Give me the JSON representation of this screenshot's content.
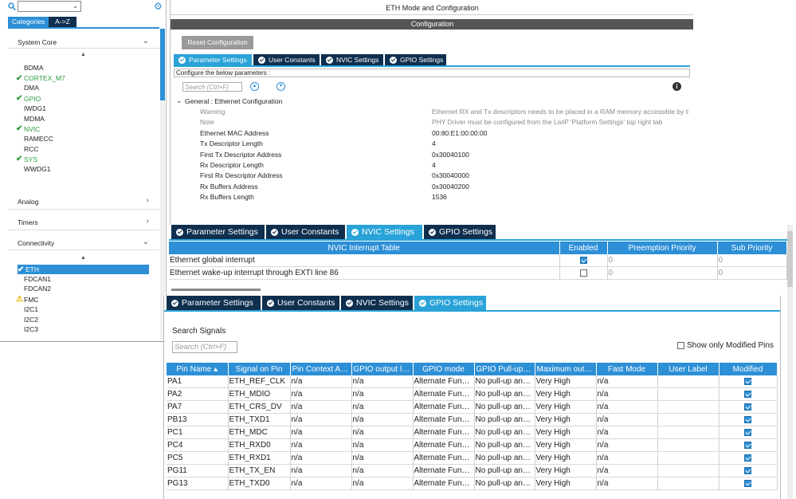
{
  "left_panel": {
    "tabs": [
      "Categories",
      "A->Z"
    ],
    "sections": {
      "system_core": "System Core",
      "analog": "Analog",
      "timers": "Timers",
      "connectivity": "Connectivity"
    },
    "system_core_items": [
      {
        "label": "BDMA",
        "state": "none"
      },
      {
        "label": "CORTEX_M7",
        "state": "ok"
      },
      {
        "label": "DMA",
        "state": "none"
      },
      {
        "label": "GPIO",
        "state": "ok"
      },
      {
        "label": "IWDG1",
        "state": "none"
      },
      {
        "label": "MDMA",
        "state": "none"
      },
      {
        "label": "NVIC",
        "state": "ok"
      },
      {
        "label": "RAMECC",
        "state": "none"
      },
      {
        "label": "RCC",
        "state": "none"
      },
      {
        "label": "SYS",
        "state": "ok"
      },
      {
        "label": "WWDG1",
        "state": "none"
      }
    ],
    "connectivity_items": [
      {
        "label": "ETH",
        "state": "selected"
      },
      {
        "label": "FDCAN1",
        "state": "none"
      },
      {
        "label": "FDCAN2",
        "state": "none"
      },
      {
        "label": "FMC",
        "state": "warn"
      },
      {
        "label": "I2C1",
        "state": "none"
      },
      {
        "label": "I2C2",
        "state": "none"
      },
      {
        "label": "I2C3",
        "state": "none"
      }
    ]
  },
  "main": {
    "title": "ETH Mode and Configuration",
    "config_header": "Configuration",
    "reset_button": "Reset Configuration",
    "tabs": [
      "Parameter Settings",
      "User Constants",
      "NVIC Settings",
      "GPIO Settings"
    ],
    "configure_label": "Configure the below parameters :",
    "search_placeholder": "Search (Ctrl+F)",
    "group_label": "General : Ethernet Configuration",
    "params": [
      {
        "name": "Warning",
        "value": "Ethernet RX and Tx descriptors needs to be placed in a RAM memory accessible by the",
        "muted": true
      },
      {
        "name": "Note",
        "value": "PHY Driver must be configured from the LwIP 'Platform Settings' top right tab",
        "muted": true
      },
      {
        "name": "Ethernet MAC Address",
        "value": "00:80:E1:00:00:00",
        "muted": false
      },
      {
        "name": "Tx Descriptor Length",
        "value": "4",
        "muted": false
      },
      {
        "name": "First Tx Descriptor Address",
        "value": "0x30040100",
        "muted": false
      },
      {
        "name": "Rx Descriptor Length",
        "value": "4",
        "muted": false
      },
      {
        "name": "First Rx Descriptor Address",
        "value": "0x30040000",
        "muted": false
      },
      {
        "name": "Rx Buffers Address",
        "value": "0x30040200",
        "muted": false
      },
      {
        "name": "Rx Buffers Length",
        "value": "1536",
        "muted": false
      }
    ]
  },
  "nvic": {
    "tabs": [
      "Parameter Settings",
      "User Constants",
      "NVIC Settings",
      "GPIO Settings"
    ],
    "columns": [
      "NVIC Interrupt Table",
      "Enabled",
      "Preemption Priority",
      "Sub Priority"
    ],
    "rows": [
      {
        "name": "Ethernet global interrupt",
        "enabled": true,
        "preemption": "0",
        "sub": "0"
      },
      {
        "name": "Ethernet wake-up interrupt through EXTI line 86",
        "enabled": false,
        "preemption": "0",
        "sub": "0"
      }
    ]
  },
  "gpio": {
    "tabs": [
      "Parameter Settings",
      "User Constants",
      "NVIC Settings",
      "GPIO Settings"
    ],
    "search_label": "Search Signals",
    "search_placeholder": "Search (Ctrl+F)",
    "show_modified_label": "Show only Modified Pins",
    "columns": [
      "Pin Name",
      "Signal on Pin",
      "Pin Context As...",
      "GPIO output level",
      "GPIO mode",
      "GPIO Pull-up/P...",
      "Maximum outpu...",
      "Fast Mode",
      "User Label",
      "Modified"
    ],
    "rows": [
      {
        "pin": "PA1",
        "signal": "ETH_REF_CLK",
        "context": "n/a",
        "level": "n/a",
        "mode": "Alternate Functi...",
        "pull": "No pull-up and ...",
        "speed": "Very High",
        "fast": "n/a",
        "label": "",
        "modified": true
      },
      {
        "pin": "PA2",
        "signal": "ETH_MDIO",
        "context": "n/a",
        "level": "n/a",
        "mode": "Alternate Functi...",
        "pull": "No pull-up and ...",
        "speed": "Very High",
        "fast": "n/a",
        "label": "",
        "modified": true
      },
      {
        "pin": "PA7",
        "signal": "ETH_CRS_DV",
        "context": "n/a",
        "level": "n/a",
        "mode": "Alternate Functi...",
        "pull": "No pull-up and ...",
        "speed": "Very High",
        "fast": "n/a",
        "label": "",
        "modified": true
      },
      {
        "pin": "PB13",
        "signal": "ETH_TXD1",
        "context": "n/a",
        "level": "n/a",
        "mode": "Alternate Functi...",
        "pull": "No pull-up and ...",
        "speed": "Very High",
        "fast": "n/a",
        "label": "",
        "modified": true
      },
      {
        "pin": "PC1",
        "signal": "ETH_MDC",
        "context": "n/a",
        "level": "n/a",
        "mode": "Alternate Functi...",
        "pull": "No pull-up and ...",
        "speed": "Very High",
        "fast": "n/a",
        "label": "",
        "modified": true
      },
      {
        "pin": "PC4",
        "signal": "ETH_RXD0",
        "context": "n/a",
        "level": "n/a",
        "mode": "Alternate Functi...",
        "pull": "No pull-up and ...",
        "speed": "Very High",
        "fast": "n/a",
        "label": "",
        "modified": true
      },
      {
        "pin": "PC5",
        "signal": "ETH_RXD1",
        "context": "n/a",
        "level": "n/a",
        "mode": "Alternate Functi...",
        "pull": "No pull-up and ...",
        "speed": "Very High",
        "fast": "n/a",
        "label": "",
        "modified": true
      },
      {
        "pin": "PG11",
        "signal": "ETH_TX_EN",
        "context": "n/a",
        "level": "n/a",
        "mode": "Alternate Functi...",
        "pull": "No pull-up and ...",
        "speed": "Very High",
        "fast": "n/a",
        "label": "",
        "modified": true
      },
      {
        "pin": "PG13",
        "signal": "ETH_TXD0",
        "context": "n/a",
        "level": "n/a",
        "mode": "Alternate Functi...",
        "pull": "No pull-up and ...",
        "speed": "Very High",
        "fast": "n/a",
        "label": "",
        "modified": true
      }
    ]
  }
}
